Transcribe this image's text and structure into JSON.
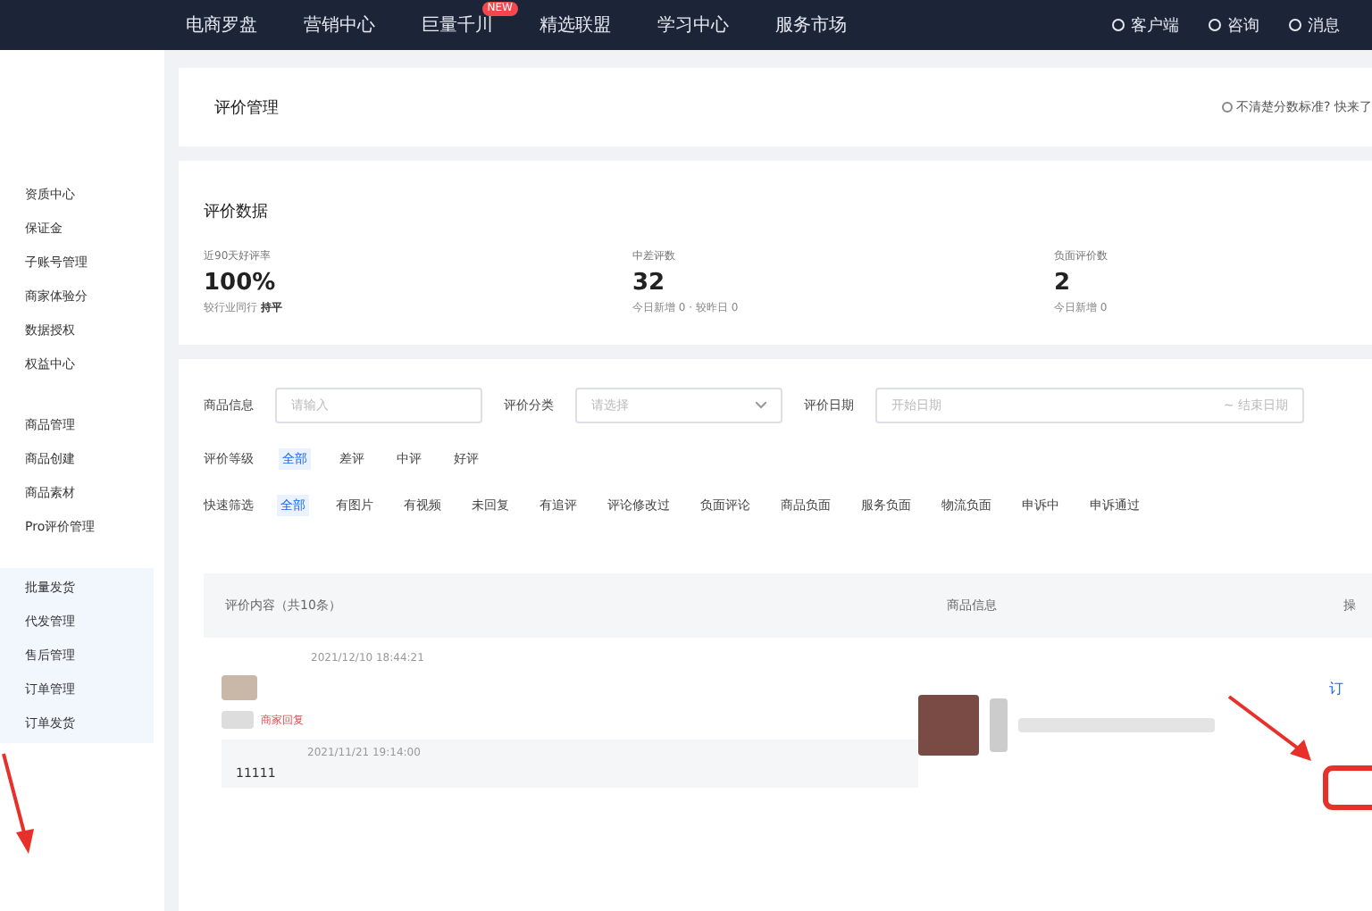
{
  "top_nav": {
    "items": [
      {
        "label": "电商罗盘"
      },
      {
        "label": "营销中心"
      },
      {
        "label": "巨量千川",
        "badge": "NEW"
      },
      {
        "label": "精选联盟"
      },
      {
        "label": "学习中心"
      },
      {
        "label": "服务市场"
      }
    ],
    "actions": [
      "客户端",
      "咨询",
      "消息"
    ]
  },
  "sidebar": {
    "groups": [
      {
        "items": [
          "资质中心",
          "保证金",
          "子账号管理",
          "商家体验分",
          "数据授权",
          "权益中心"
        ]
      },
      {
        "items": [
          "商品管理",
          "商品创建",
          "商品素材",
          "Pro评价管理"
        ]
      },
      {
        "items": [
          "批量发货",
          "代发管理",
          "售后管理",
          "订单管理",
          "订单发货"
        ]
      }
    ]
  },
  "page_header": {
    "title": "评价管理",
    "help_link": "不清楚分数标准? 快来了"
  },
  "stats": {
    "title": "评价数据",
    "cards": [
      {
        "label": "近90天好评率",
        "value": "100%",
        "note": "较行业同行",
        "note_strong": "持平"
      },
      {
        "label": "中差评数",
        "value": "32",
        "note": "今日新增 0 · 较昨日 0"
      },
      {
        "label": "负面评价数",
        "value": "2",
        "note": "今日新增 0"
      }
    ]
  },
  "filters": {
    "product": {
      "label": "商品信息",
      "placeholder": "请输入"
    },
    "category": {
      "label": "评价分类",
      "placeholder": "请选择"
    },
    "date": {
      "label": "评价日期",
      "start_placeholder": "开始日期",
      "end_placeholder": "~ 结束日期"
    },
    "level": {
      "label": "评价等级",
      "options": [
        {
          "label": "全部",
          "selected": true
        },
        {
          "label": "差评",
          "selected": false
        },
        {
          "label": "中评",
          "selected": false
        },
        {
          "label": "好评",
          "selected": false
        }
      ]
    },
    "quick": {
      "label": "快速筛选",
      "options": [
        {
          "label": "全部",
          "selected": true
        },
        {
          "label": "有图片",
          "selected": false
        },
        {
          "label": "有视频",
          "selected": false
        },
        {
          "label": "未回复",
          "selected": false
        },
        {
          "label": "有追评",
          "selected": false
        },
        {
          "label": "评论修改过",
          "selected": false
        },
        {
          "label": "负面评论",
          "selected": false
        },
        {
          "label": "商品负面",
          "selected": false
        },
        {
          "label": "服务负面",
          "selected": false
        },
        {
          "label": "物流负面",
          "selected": false
        },
        {
          "label": "申诉中",
          "selected": false
        },
        {
          "label": "申诉通过",
          "selected": false
        }
      ]
    }
  },
  "table": {
    "columns": [
      "评价内容（共10条）",
      "商品信息",
      "操"
    ],
    "rows": [
      {
        "date": "2021/12/10 18:44:21",
        "tag": "商家回复",
        "reply_date": "2021/11/21 19:14:00",
        "reply": "11111",
        "action": "订"
      }
    ]
  }
}
